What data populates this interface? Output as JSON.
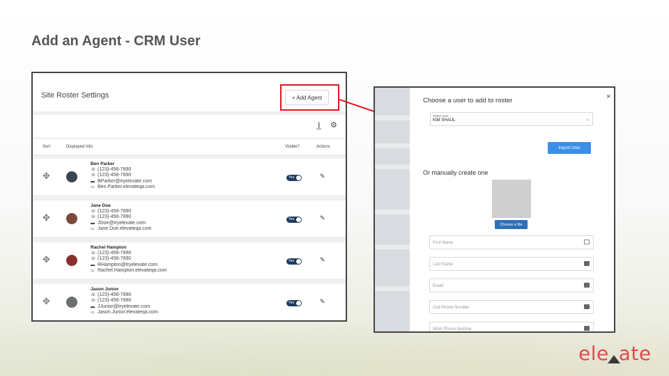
{
  "slide": {
    "title": "Add an Agent - CRM User"
  },
  "roster": {
    "title": "Site Roster Settings",
    "add_agent_label": "+ Add Agent",
    "columns": [
      "Sort",
      "Displayed Info",
      "Visible?",
      "Actions"
    ],
    "toggle_label": "Yes",
    "agents": [
      {
        "name": "Ben Parker",
        "office": "(123)-456-7890",
        "phone": "(123)-456-7890",
        "email": "BParker@tryelevate.com",
        "site": "Ben.Parker.elevateqa.com",
        "avatar_color": "#3d4650"
      },
      {
        "name": "Jane Doe",
        "office": "(123)-456-7890",
        "phone": "(123)-456-7890",
        "email": "JDoe@tryelevate.com",
        "site": "Jane.Doe.elevateqa.com",
        "avatar_color": "#7a4a3c"
      },
      {
        "name": "Rachel Hampton",
        "office": "(123)-456-7890",
        "phone": "(123)-456-7890",
        "email": "RHampton@tryelevate.com",
        "site": "Rachel.Hampton.elevateqa.com",
        "avatar_color": "#8a2f2a"
      },
      {
        "name": "Jason Junior",
        "office": "(123)-456-7890",
        "phone": "(123)-456-7890",
        "email": "JJunior@tryelevate.com",
        "site": "Jason.Junior.elevateqa.com",
        "avatar_color": "#6b6f70"
      }
    ]
  },
  "modal": {
    "title": "Choose a user to add to roster",
    "select_label": "Select user",
    "select_value": "KIM SHAUL",
    "import_label": "Import User",
    "manual_title": "Or manually create one",
    "choose_file_label": "Choose a file",
    "fields": [
      "First Name",
      "Last Name",
      "Email",
      "Cell Phone Number",
      "Work Phone Number"
    ]
  },
  "logo": {
    "left": "ele",
    "right": "ate"
  },
  "colors": {
    "highlight": "#e0171e",
    "import_button": "#3b8fe8",
    "choose_button": "#2f6fb8",
    "logo": "#e24a4a"
  }
}
